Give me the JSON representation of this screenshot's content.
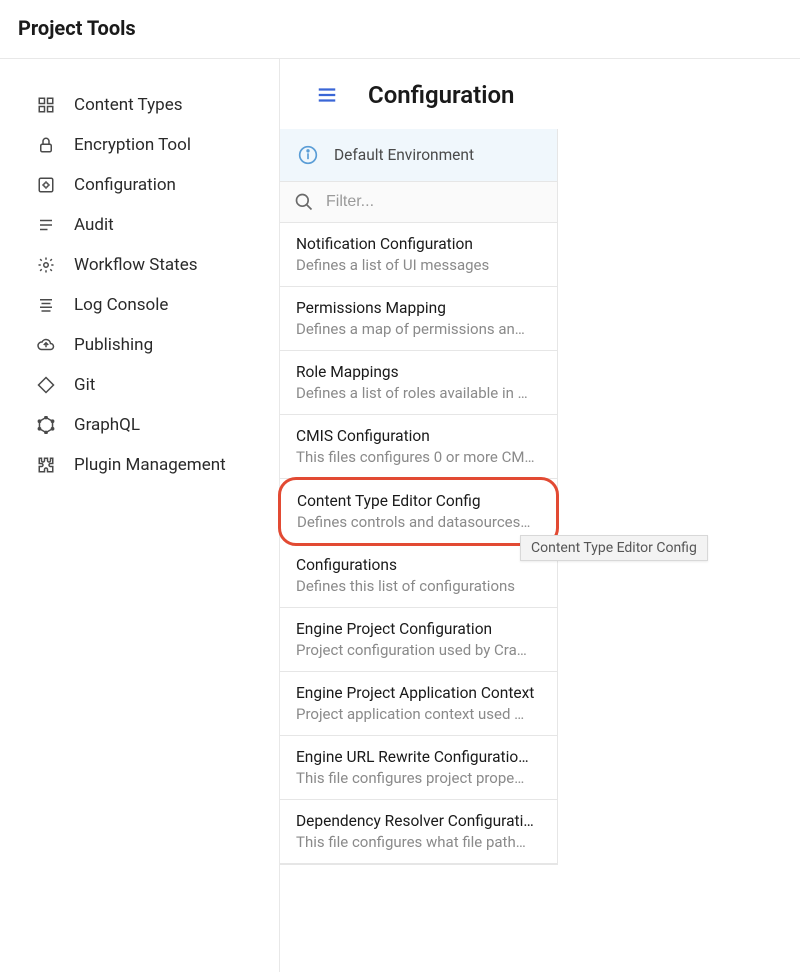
{
  "header": {
    "title": "Project Tools"
  },
  "sidebar": {
    "items": [
      {
        "label": "Content Types",
        "icon": "widgets"
      },
      {
        "label": "Encryption Tool",
        "icon": "lock"
      },
      {
        "label": "Configuration",
        "icon": "settings-box"
      },
      {
        "label": "Audit",
        "icon": "list"
      },
      {
        "label": "Workflow States",
        "icon": "gear"
      },
      {
        "label": "Log Console",
        "icon": "align"
      },
      {
        "label": "Publishing",
        "icon": "cloud-up"
      },
      {
        "label": "Git",
        "icon": "diamond"
      },
      {
        "label": "GraphQL",
        "icon": "hexagon"
      },
      {
        "label": "Plugin Management",
        "icon": "puzzle"
      }
    ]
  },
  "main": {
    "title": "Configuration",
    "environment_label": "Default Environment",
    "filter_placeholder": "Filter...",
    "tooltip": "Content Type Editor Config",
    "items": [
      {
        "title": "Notification Configuration",
        "desc": "Defines a list of UI messages"
      },
      {
        "title": "Permissions Mapping",
        "desc": "Defines a map of permissions an…"
      },
      {
        "title": "Role Mappings",
        "desc": "Defines a list of roles available in …"
      },
      {
        "title": "CMIS Configuration",
        "desc": "This files configures 0 or more CM…"
      },
      {
        "title": "Content Type Editor Config",
        "desc": "Defines controls and datasources…"
      },
      {
        "title": "Configurations",
        "desc": "Defines this list of configurations"
      },
      {
        "title": "Engine Project Configuration",
        "desc": "Project configuration used by Cra…"
      },
      {
        "title": "Engine Project Application Context",
        "desc": "Project application context used …"
      },
      {
        "title": "Engine URL Rewrite Configuratio…",
        "desc": "This file configures project prope…"
      },
      {
        "title": "Dependency Resolver Configurati…",
        "desc": "This file configures what file path…"
      }
    ]
  }
}
